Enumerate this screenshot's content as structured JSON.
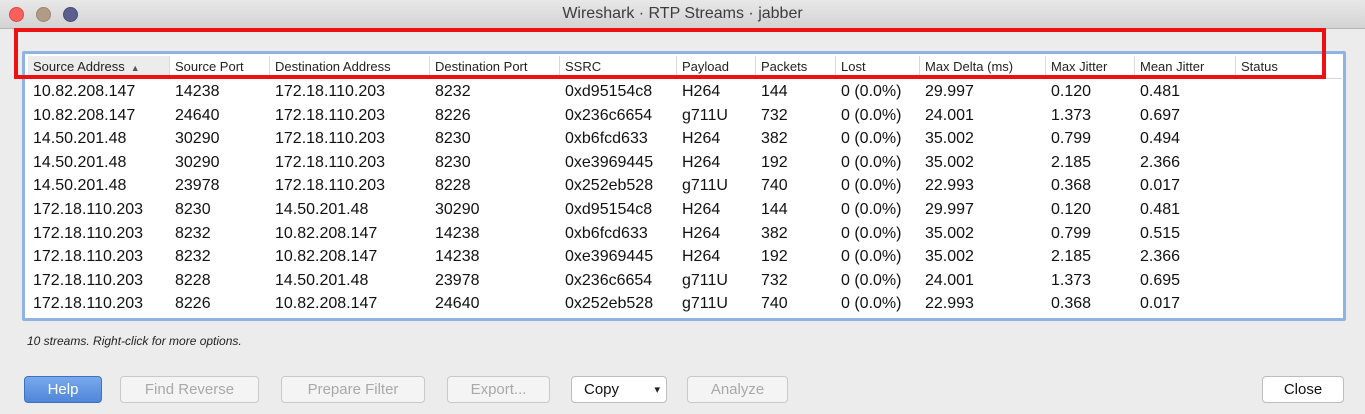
{
  "window": {
    "title": "Wireshark · RTP Streams · jabber"
  },
  "table": {
    "columns": [
      "Source Address",
      "Source Port",
      "Destination Address",
      "Destination Port",
      "SSRC",
      "Payload",
      "Packets",
      "Lost",
      "Max Delta (ms)",
      "Max Jitter",
      "Mean Jitter",
      "Status"
    ],
    "sort_indicator": "▲",
    "rows": [
      [
        "10.82.208.147",
        "14238",
        "172.18.110.203",
        "8232",
        "0xd95154c8",
        "H264",
        "144",
        "0 (0.0%)",
        "29.997",
        "0.120",
        "0.481",
        ""
      ],
      [
        "10.82.208.147",
        "24640",
        "172.18.110.203",
        "8226",
        "0x236c6654",
        "g711U",
        "732",
        "0 (0.0%)",
        "24.001",
        "1.373",
        "0.697",
        ""
      ],
      [
        "14.50.201.48",
        "30290",
        "172.18.110.203",
        "8230",
        "0xb6fcd633",
        "H264",
        "382",
        "0 (0.0%)",
        "35.002",
        "0.799",
        "0.494",
        ""
      ],
      [
        "14.50.201.48",
        "30290",
        "172.18.110.203",
        "8230",
        "0xe3969445",
        "H264",
        "192",
        "0 (0.0%)",
        "35.002",
        "2.185",
        "2.366",
        ""
      ],
      [
        "14.50.201.48",
        "23978",
        "172.18.110.203",
        "8228",
        "0x252eb528",
        "g711U",
        "740",
        "0 (0.0%)",
        "22.993",
        "0.368",
        "0.017",
        ""
      ],
      [
        "172.18.110.203",
        "8230",
        "14.50.201.48",
        "30290",
        "0xd95154c8",
        "H264",
        "144",
        "0 (0.0%)",
        "29.997",
        "0.120",
        "0.481",
        ""
      ],
      [
        "172.18.110.203",
        "8232",
        "10.82.208.147",
        "14238",
        "0xb6fcd633",
        "H264",
        "382",
        "0 (0.0%)",
        "35.002",
        "0.799",
        "0.515",
        ""
      ],
      [
        "172.18.110.203",
        "8232",
        "10.82.208.147",
        "14238",
        "0xe3969445",
        "H264",
        "192",
        "0 (0.0%)",
        "35.002",
        "2.185",
        "2.366",
        ""
      ],
      [
        "172.18.110.203",
        "8228",
        "14.50.201.48",
        "23978",
        "0x236c6654",
        "g711U",
        "732",
        "0 (0.0%)",
        "24.001",
        "1.373",
        "0.695",
        ""
      ],
      [
        "172.18.110.203",
        "8226",
        "10.82.208.147",
        "24640",
        "0x252eb528",
        "g711U",
        "740",
        "0 (0.0%)",
        "22.993",
        "0.368",
        "0.017",
        ""
      ]
    ]
  },
  "status": {
    "text": "10 streams. Right-click for more options."
  },
  "buttons": {
    "help": "Help",
    "find_reverse": "Find Reverse",
    "prepare_filter": "Prepare Filter",
    "export": "Export...",
    "copy": "Copy",
    "copy_arrow": "▾",
    "analyze": "Analyze",
    "close": "Close"
  },
  "colors": {
    "highlight_box": "#ee1111",
    "focus_ring": "#8fb4e4",
    "primary_button": "#4f86d8"
  }
}
